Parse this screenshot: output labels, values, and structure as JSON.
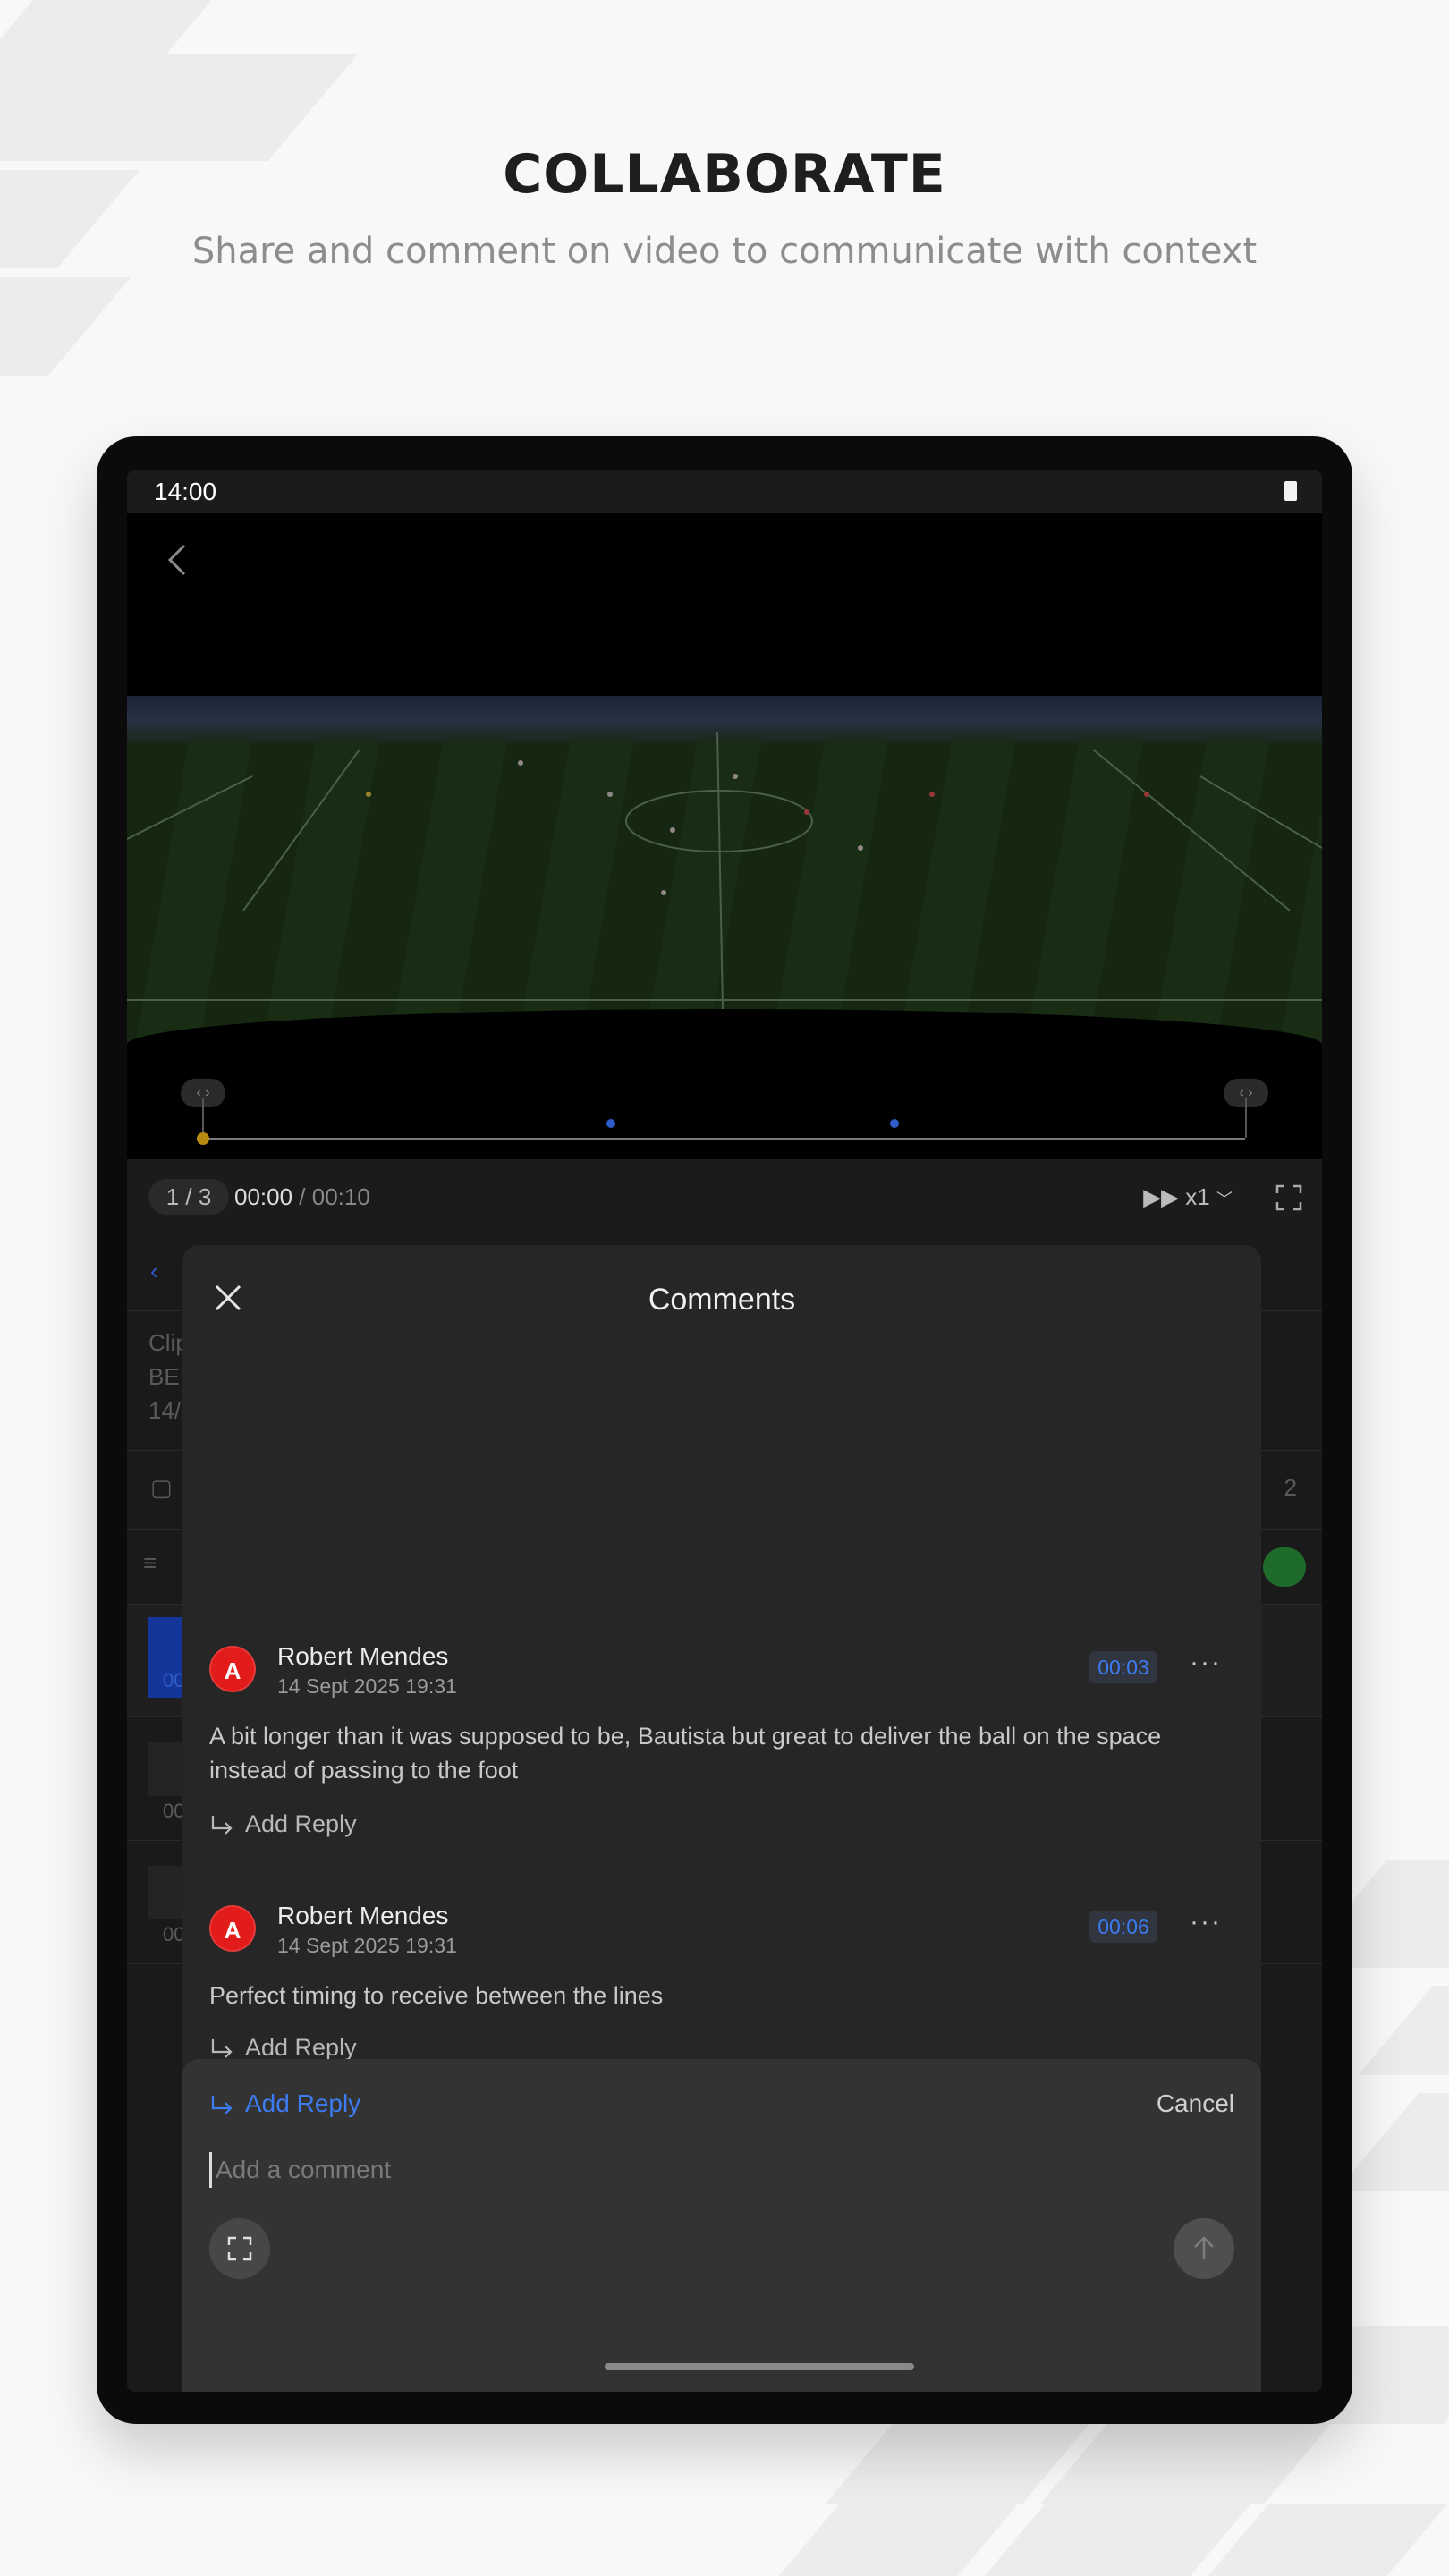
{
  "page": {
    "title": "COLLABORATE",
    "subtitle": "Share and comment on video to communicate with context"
  },
  "status_bar": {
    "time": "14:00"
  },
  "player": {
    "counter": "1 / 3",
    "current_time": "00:00",
    "separator": " / ",
    "duration": "00:10",
    "speed": "x1",
    "progress": 0.0
  },
  "background_list": {
    "clip_label": "Clip",
    "line2": "BEI",
    "line3": "14/",
    "comment_count": "2",
    "row_time_1": "00",
    "row_time_2": "00",
    "row_time_3": "00"
  },
  "comments_panel": {
    "title": "Comments",
    "comments": [
      {
        "avatar_letter": "A",
        "author": "Robert Mendes",
        "date": "14 Sept 2025 19:31",
        "timestamp": "00:03",
        "text": "A bit longer than it was supposed to be, Bautista but great to deliver the ball on the space instead of passing to the foot",
        "reply_label": "Add Reply"
      },
      {
        "avatar_letter": "A",
        "author": "Robert Mendes",
        "date": "14 Sept 2025 19:31",
        "timestamp": "00:06",
        "text": "Perfect timing to receive between the lines",
        "reply_label": "Add Reply"
      }
    ]
  },
  "composer": {
    "reply_label": "Add Reply",
    "cancel_label": "Cancel",
    "placeholder": "Add a comment"
  },
  "colors": {
    "accent": "#3d7bf0",
    "avatar": "#e21b1b",
    "panel": "#262626",
    "composer": "#333333"
  }
}
